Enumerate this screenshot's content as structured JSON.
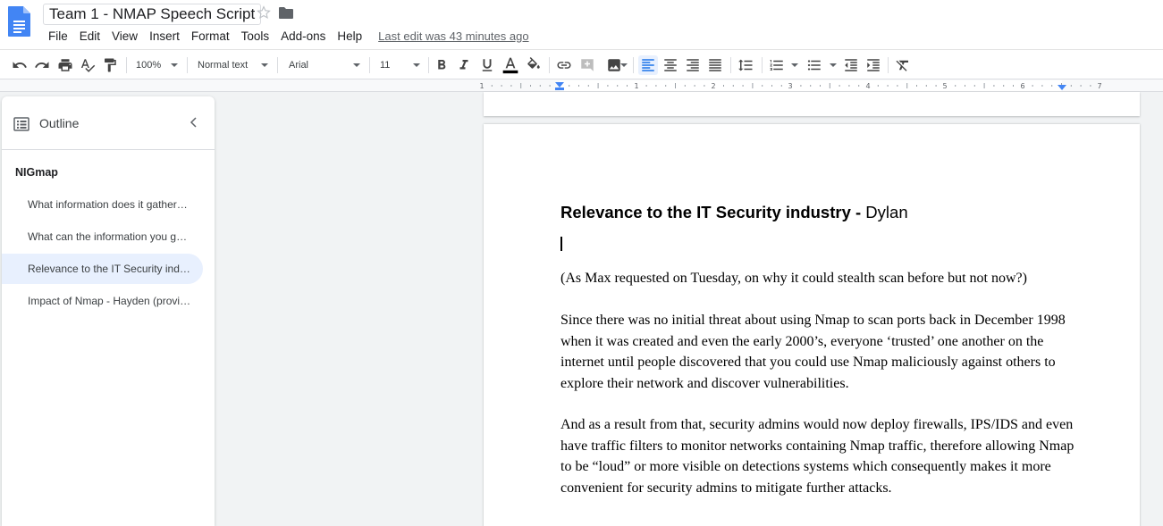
{
  "header": {
    "doc_title": "Team 1 - NMAP Speech Script",
    "menu": [
      "File",
      "Edit",
      "View",
      "Insert",
      "Format",
      "Tools",
      "Add-ons",
      "Help"
    ],
    "last_edit": "Last edit was 43 minutes ago",
    "icons": {
      "logo": "docs-logo-icon",
      "star": "star-icon",
      "folder": "folder-icon"
    }
  },
  "toolbar": {
    "zoom": "100%",
    "style": "Normal text",
    "font": "Arial",
    "size": "11",
    "active_alignment": "left",
    "text_color": "#000000"
  },
  "ruler": {
    "numbers": [
      "1",
      "1",
      "2",
      "3",
      "4",
      "5",
      "6",
      "7"
    ]
  },
  "outline": {
    "title": "Outline",
    "doc_heading": "NIGmap",
    "items": [
      "What information does it gather…",
      "What can the information you g…",
      "Relevance to the IT Security ind…",
      "Impact of Nmap - Hayden (provi…"
    ],
    "selected_index": 2
  },
  "document": {
    "heading_bold": "Relevance to the IT Security industry -",
    "heading_normal": " Dylan",
    "paragraphs": [
      "(As Max requested on Tuesday, on why it could stealth scan before but not now?)",
      "Since there was no initial threat about using Nmap to scan ports back in December 1998 when it was created and even the early 2000’s, everyone ‘trusted’ one another on the internet until people discovered that you could use Nmap maliciously against others to explore their network and discover vulnerabilities.",
      "And as a result from that, security admins would now deploy firewalls, IPS/IDS and even have traffic filters to monitor networks containing Nmap traffic, therefore allowing Nmap to be “loud” or more visible on detections systems which consequently makes it more convenient for security admins to mitigate further attacks."
    ]
  },
  "colors": {
    "accent": "#1a73e8",
    "selected_bg": "#e8f0fe",
    "canvas": "#f1f3f4"
  }
}
